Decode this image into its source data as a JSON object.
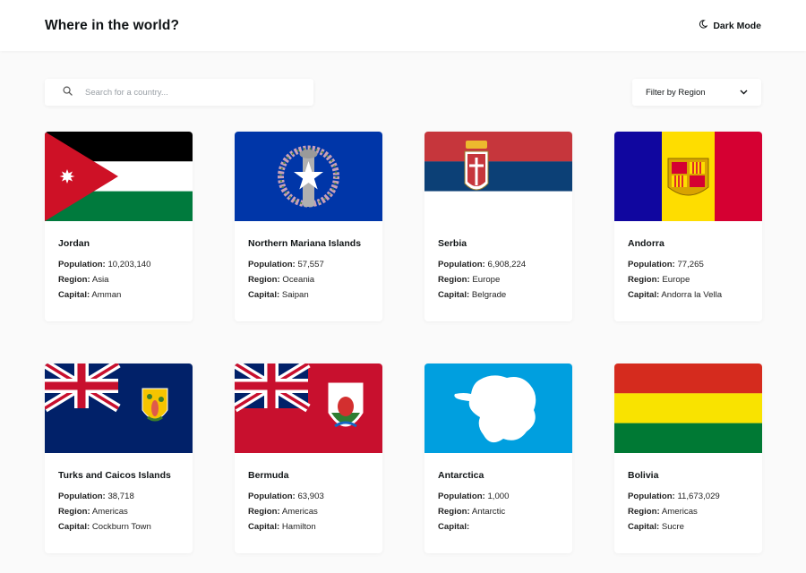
{
  "header": {
    "title": "Where in the world?",
    "dark_mode_label": "Dark Mode",
    "dark_mode_icon": "moon-icon"
  },
  "search": {
    "placeholder": "Search for a country...",
    "value": "",
    "icon": "search-icon"
  },
  "filter": {
    "label": "Filter by Region",
    "icon": "chevron-down-icon"
  },
  "labels": {
    "population": "Population:",
    "region": "Region:",
    "capital": "Capital:"
  },
  "countries": [
    {
      "name": "Jordan",
      "population": "10,203,140",
      "region": "Asia",
      "capital": "Amman",
      "flag": "flag-jordan"
    },
    {
      "name": "Northern Mariana Islands",
      "population": "57,557",
      "region": "Oceania",
      "capital": "Saipan",
      "flag": "flag-northern-mariana-islands"
    },
    {
      "name": "Serbia",
      "population": "6,908,224",
      "region": "Europe",
      "capital": "Belgrade",
      "flag": "flag-serbia"
    },
    {
      "name": "Andorra",
      "population": "77,265",
      "region": "Europe",
      "capital": "Andorra la Vella",
      "flag": "flag-andorra"
    },
    {
      "name": "Turks and Caicos Islands",
      "population": "38,718",
      "region": "Americas",
      "capital": "Cockburn Town",
      "flag": "flag-turks-and-caicos"
    },
    {
      "name": "Bermuda",
      "population": "63,903",
      "region": "Americas",
      "capital": "Hamilton",
      "flag": "flag-bermuda"
    },
    {
      "name": "Antarctica",
      "population": "1,000",
      "region": "Antarctic",
      "capital": "",
      "flag": "flag-antarctica"
    },
    {
      "name": "Bolivia",
      "population": "11,673,029",
      "region": "Americas",
      "capital": "Sucre",
      "flag": "flag-bolivia"
    }
  ],
  "colors": {
    "background": "#fafafa",
    "card": "#ffffff",
    "text": "#111517"
  }
}
